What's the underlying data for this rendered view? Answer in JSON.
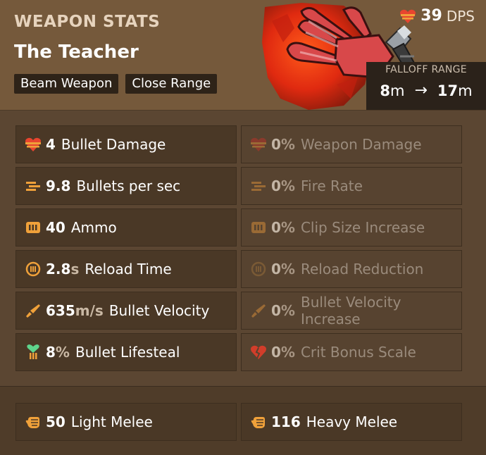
{
  "header": {
    "eyebrow": "WEAPON STATS",
    "weapon_name": "The Teacher",
    "tags": [
      "Beam Weapon",
      "Close Range"
    ]
  },
  "dps": {
    "value": "39",
    "unit": "DPS",
    "icon": "heart-bullet-icon"
  },
  "falloff": {
    "title": "FALLOFF RANGE",
    "from_value": "8",
    "from_unit": "m",
    "arrow": "→",
    "to_value": "17",
    "to_unit": "m"
  },
  "stats": [
    {
      "left": {
        "icon": "bullet-damage-icon",
        "value": "4",
        "unit": "",
        "label": "Bullet Damage"
      },
      "right": {
        "icon": "weapon-damage-icon",
        "value": "0",
        "unit": "%",
        "label": "Weapon Damage"
      }
    },
    {
      "left": {
        "icon": "fire-rate-icon",
        "value": "9.8",
        "unit": "",
        "label": "Bullets per sec"
      },
      "right": {
        "icon": "fire-rate-icon",
        "value": "0",
        "unit": "%",
        "label": "Fire Rate"
      }
    },
    {
      "left": {
        "icon": "ammo-icon",
        "value": "40",
        "unit": "",
        "label": "Ammo"
      },
      "right": {
        "icon": "ammo-icon",
        "value": "0",
        "unit": "%",
        "label": "Clip Size Increase"
      }
    },
    {
      "left": {
        "icon": "reload-icon",
        "value": "2.8",
        "unit": "s",
        "label": "Reload Time"
      },
      "right": {
        "icon": "reload-icon",
        "value": "0",
        "unit": "%",
        "label": "Reload Reduction"
      }
    },
    {
      "left": {
        "icon": "bullet-velocity-icon",
        "value": "635",
        "unit": "m/s",
        "label": "Bullet Velocity"
      },
      "right": {
        "icon": "bullet-velocity-icon",
        "value": "0",
        "unit": "%",
        "label": "Bullet Velocity Increase"
      }
    },
    {
      "left": {
        "icon": "lifesteal-icon",
        "value": "8",
        "unit": "%",
        "label": "Bullet Lifesteal"
      },
      "right": {
        "icon": "crit-icon",
        "value": "0",
        "unit": "%",
        "label": "Crit Bonus Scale"
      }
    }
  ],
  "melee": {
    "light": {
      "icon": "fist-icon",
      "value": "50",
      "label": "Light Melee"
    },
    "heavy": {
      "icon": "fist-icon",
      "value": "116",
      "label": "Heavy Melee"
    }
  },
  "colors": {
    "accent_orange": "#f0a13a",
    "heart_red": "#e8452f",
    "lifesteal_green": "#5fd48c",
    "crit_red": "#d23d2a",
    "tag_bg": "#2e2318"
  }
}
